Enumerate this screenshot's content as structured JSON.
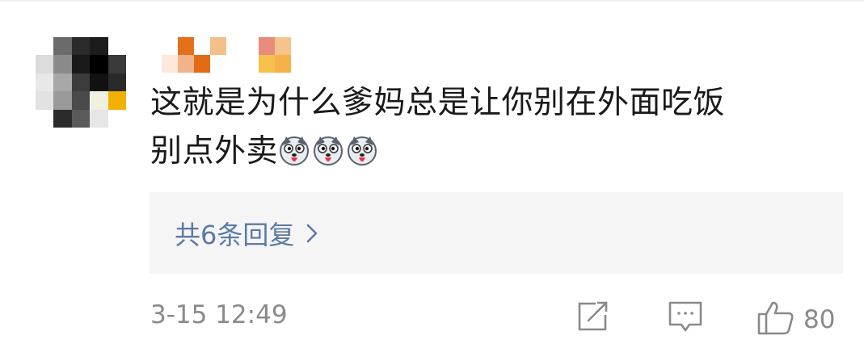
{
  "comment": {
    "line1": "这就是为什么爹妈总是让你别在外面吃饭",
    "line2": "别点外卖",
    "emojis": [
      {
        "icon": "husky-dog-face-icon"
      },
      {
        "icon": "husky-dog-face-icon"
      },
      {
        "icon": "husky-dog-face-icon"
      }
    ]
  },
  "replies": {
    "label": "共6条回复",
    "chevron_icon": "chevron-right-icon"
  },
  "meta": {
    "timestamp": "3-15 12:49"
  },
  "actions": {
    "share_icon": "share-icon",
    "comment_icon": "comment-icon",
    "like_icon": "thumbs-up-icon",
    "like_count": "80"
  },
  "colors": {
    "text": "#1a1a1a",
    "link": "#5b7aa6",
    "meta": "#8a8a8a",
    "reply_bg": "#f5f5f5"
  }
}
